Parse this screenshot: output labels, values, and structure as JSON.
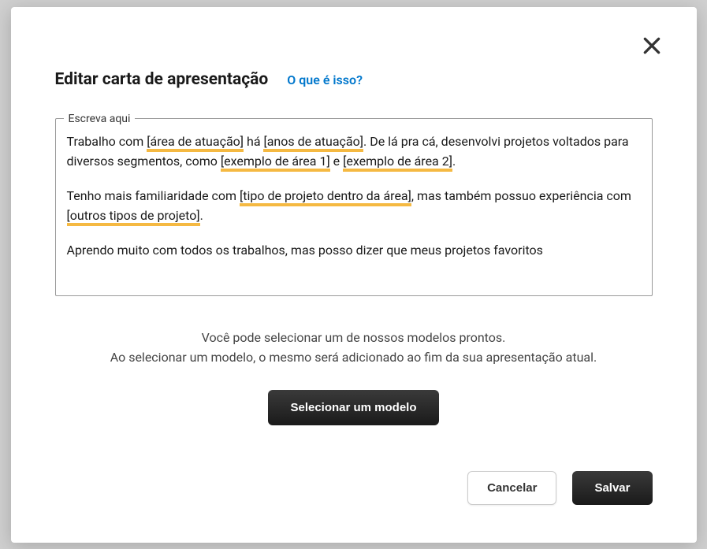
{
  "modal": {
    "title": "Editar carta de apresentação",
    "help_link": "O que é isso?",
    "textarea_label": "Escreva aqui",
    "content": {
      "p1_pre": "Trabalho com ",
      "p1_hl1": "[área de atuação]",
      "p1_mid1": " há ",
      "p1_hl2": "[anos de atuação]",
      "p1_mid2": ". De lá pra cá, desenvolvi projetos voltados para diversos segmentos, como ",
      "p1_hl3": "[exemplo de área 1]",
      "p1_mid3": " e ",
      "p1_hl4": "[exemplo de área 2]",
      "p1_end": ".",
      "p2_pre": "Tenho mais familiaridade com ",
      "p2_hl1": "[tipo de projeto dentro da área]",
      "p2_mid1": ", mas também possuo experiência com ",
      "p2_hl2": "[outros tipos de projeto]",
      "p2_end": ".",
      "p3": "Aprendo muito com todos os trabalhos, mas posso dizer que meus projetos favoritos"
    },
    "hint_line1": "Você pode selecionar um de nossos modelos prontos.",
    "hint_line2": "Ao selecionar um modelo, o mesmo será adicionado ao fim da sua apresentação atual.",
    "select_model_label": "Selecionar um modelo",
    "cancel_label": "Cancelar",
    "save_label": "Salvar"
  }
}
